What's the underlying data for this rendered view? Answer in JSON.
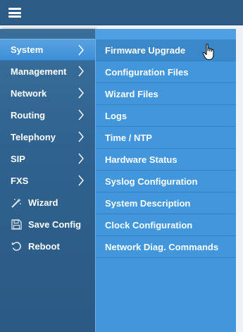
{
  "header": {
    "menu_icon": "hamburger-menu-icon"
  },
  "sidebar": {
    "items": [
      {
        "label": "System",
        "icon": "chevron-right-icon",
        "active": true
      },
      {
        "label": "Management",
        "icon": "chevron-right-icon"
      },
      {
        "label": "Network",
        "icon": "chevron-right-icon"
      },
      {
        "label": "Routing",
        "icon": "chevron-right-icon"
      },
      {
        "label": "Telephony",
        "icon": "chevron-right-icon"
      },
      {
        "label": "SIP",
        "icon": "chevron-right-icon"
      },
      {
        "label": "FXS",
        "icon": "chevron-right-icon"
      },
      {
        "label": "Wizard",
        "icon": "magic-wand-icon"
      },
      {
        "label": "Save Config",
        "icon": "floppy-disk-icon"
      },
      {
        "label": "Reboot",
        "icon": "reboot-icon"
      }
    ]
  },
  "submenu": {
    "items": [
      {
        "label": "Firmware Upgrade",
        "hover": true
      },
      {
        "label": "Configuration Files"
      },
      {
        "label": "Wizard Files"
      },
      {
        "label": "Logs"
      },
      {
        "label": "Time / NTP"
      },
      {
        "label": "Hardware Status"
      },
      {
        "label": "Syslog Configuration"
      },
      {
        "label": "System Description"
      },
      {
        "label": "Clock Configuration"
      },
      {
        "label": "Network Diag. Commands"
      }
    ]
  },
  "colors": {
    "topbar": "#2d5c86",
    "sidebar": "#2f628f",
    "active": "#4a9ae0",
    "submenu": "#4196dc"
  }
}
